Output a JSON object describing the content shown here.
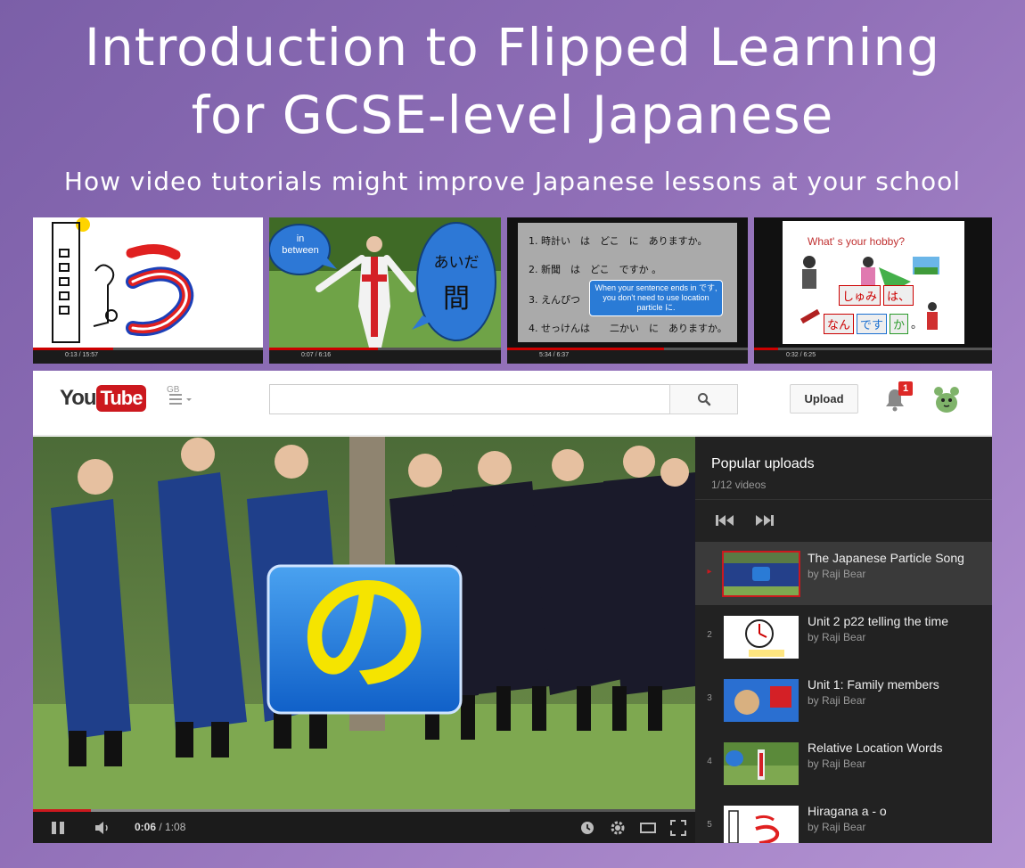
{
  "slide": {
    "title_line1": "Introduction to Flipped Learning",
    "title_line2": "for GCSE-level Japanese",
    "subtitle": "How video tutorials might improve Japanese lessons at your school"
  },
  "thumbnails": [
    {
      "name": "kanji-strokes",
      "progress": 0.35,
      "time": "0:13 / 15:57"
    },
    {
      "name": "in-between",
      "progress": 0.47,
      "time": "0:07 / 6:16",
      "bubble_left": "in\nbetween",
      "bubble_right_kana": "あいだ",
      "bubble_right_kanji": "間"
    },
    {
      "name": "location-particle",
      "progress": 0.65,
      "time": "5:34 / 6:37",
      "lines": [
        "1. 時計い　は　どこ　に　ありますか。",
        "2. 新聞　は　どこ　ですか 。",
        "3. えんぴつ",
        "4. せっけんは　　二かい　に　ありますか。"
      ],
      "callout": "When your sentence ends in です, you don't need to use location particle に."
    },
    {
      "name": "hobby",
      "progress": 0.1,
      "time": "0:32 / 6:25",
      "question": "What' s your hobby?",
      "words1": [
        "しゅみ",
        "は、"
      ],
      "words2": [
        "なん",
        "です",
        "か",
        "。"
      ]
    }
  ],
  "youtube": {
    "logo_you": "You",
    "logo_tube": "Tube",
    "logo_region": "GB",
    "search_placeholder": "",
    "upload_label": "Upload",
    "notification_count": "1",
    "player": {
      "character": "の",
      "current_time": "0:06",
      "separator": " / ",
      "duration": "1:08",
      "progress": 0.088,
      "buffered": 0.72
    },
    "playlist": {
      "title": "Popular uploads",
      "count": "1/12 videos",
      "items": [
        {
          "index": "▸",
          "title": "The Japanese Particle Song",
          "channel": "by Raji Bear",
          "active": true
        },
        {
          "index": "2",
          "title": "Unit 2 p22 telling the time",
          "channel": "by Raji Bear",
          "active": false
        },
        {
          "index": "3",
          "title": "Unit 1: Family members",
          "channel": "by Raji Bear",
          "active": false
        },
        {
          "index": "4",
          "title": "Relative Location Words",
          "channel": "by Raji Bear",
          "active": false
        },
        {
          "index": "5",
          "title": "Hiragana a - o",
          "channel": "by Raji Bear",
          "active": false
        }
      ]
    }
  },
  "colors": {
    "youtube_red": "#cc181e",
    "panel_dark": "#222222",
    "badge_red": "#dd2826",
    "accent_blue": "#1f6fd1",
    "accent_yellow": "#f5e400"
  }
}
